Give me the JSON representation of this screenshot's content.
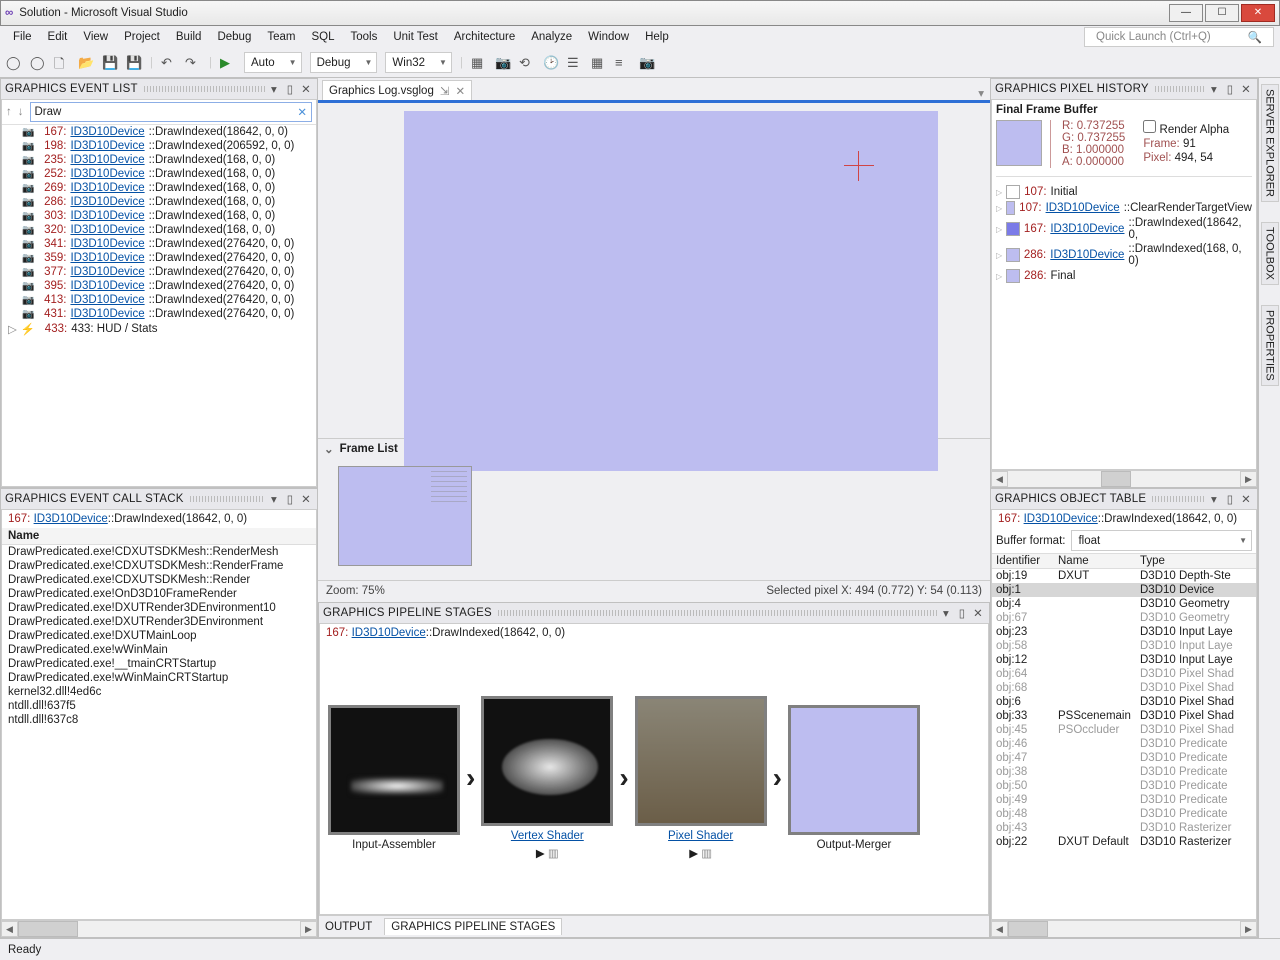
{
  "title": "Solution - Microsoft Visual Studio",
  "menubar": [
    "File",
    "Edit",
    "View",
    "Project",
    "Build",
    "Debug",
    "Team",
    "SQL",
    "Tools",
    "Unit Test",
    "Architecture",
    "Analyze",
    "Window",
    "Help"
  ],
  "quick_launch_placeholder": "Quick Launch (Ctrl+Q)",
  "toolbar": {
    "config_combo": "Auto",
    "solution_config": "Debug",
    "platform": "Win32"
  },
  "doc_tab": "Graphics Log.vsglog",
  "event_list": {
    "title": "GRAPHICS EVENT LIST",
    "filter": "Draw",
    "rows": [
      {
        "n": "167",
        "sig": "::DrawIndexed(18642, 0, 0)"
      },
      {
        "n": "198",
        "sig": "::DrawIndexed(206592, 0, 0)"
      },
      {
        "n": "235",
        "sig": "::DrawIndexed(168, 0, 0)"
      },
      {
        "n": "252",
        "sig": "::DrawIndexed(168, 0, 0)"
      },
      {
        "n": "269",
        "sig": "::DrawIndexed(168, 0, 0)"
      },
      {
        "n": "286",
        "sig": "::DrawIndexed(168, 0, 0)"
      },
      {
        "n": "303",
        "sig": "::DrawIndexed(168, 0, 0)"
      },
      {
        "n": "320",
        "sig": "::DrawIndexed(168, 0, 0)"
      },
      {
        "n": "341",
        "sig": "::DrawIndexed(276420, 0, 0)"
      },
      {
        "n": "359",
        "sig": "::DrawIndexed(276420, 0, 0)"
      },
      {
        "n": "377",
        "sig": "::DrawIndexed(276420, 0, 0)"
      },
      {
        "n": "395",
        "sig": "::DrawIndexed(276420, 0, 0)"
      },
      {
        "n": "413",
        "sig": "::DrawIndexed(276420, 0, 0)"
      },
      {
        "n": "431",
        "sig": "::DrawIndexed(276420, 0, 0)"
      }
    ],
    "last_row": "433: HUD / Stats",
    "link": "ID3D10Device"
  },
  "frame_list_label": "Frame List",
  "zoom": "Zoom: 75%",
  "selected_pixel": "Selected pixel X: 494 (0.772) Y: 54 (0.113)",
  "callstack": {
    "title": "GRAPHICS EVENT CALL STACK",
    "context_num": "167:",
    "context_link": "ID3D10Device",
    "context_sig": "::DrawIndexed(18642, 0, 0)",
    "header": "Name",
    "rows": [
      "DrawPredicated.exe!CDXUTSDKMesh::RenderMesh",
      "DrawPredicated.exe!CDXUTSDKMesh::RenderFrame",
      "DrawPredicated.exe!CDXUTSDKMesh::Render",
      "DrawPredicated.exe!OnD3D10FrameRender",
      "DrawPredicated.exe!DXUTRender3DEnvironment10",
      "DrawPredicated.exe!DXUTRender3DEnvironment",
      "DrawPredicated.exe!DXUTMainLoop",
      "DrawPredicated.exe!wWinMain",
      "DrawPredicated.exe!__tmainCRTStartup",
      "DrawPredicated.exe!wWinMainCRTStartup",
      "kernel32.dll!4ed6c",
      "ntdll.dll!637f5",
      "ntdll.dll!637c8"
    ]
  },
  "pipeline": {
    "title": "GRAPHICS PIPELINE STAGES",
    "context_num": "167:",
    "context_link": "ID3D10Device",
    "context_sig": "::DrawIndexed(18642, 0, 0)",
    "stages": [
      "Input-Assembler",
      "Vertex Shader",
      "Pixel Shader",
      "Output-Merger"
    ]
  },
  "bottom_tabs": [
    "OUTPUT",
    "GRAPHICS PIPELINE STAGES"
  ],
  "pixel_history": {
    "title": "GRAPHICS PIXEL HISTORY",
    "subtitle": "Final Frame Buffer",
    "rgba": [
      "R:   0.737255",
      "G:   0.737255",
      "B:   1.000000",
      "A:   0.000000"
    ],
    "render_alpha": "Render Alpha",
    "frame_label": "Frame:",
    "frame_value": "91",
    "pixel_label": "Pixel:",
    "pixel_value": "494, 54",
    "rows": [
      {
        "n": "107:",
        "text": "Initial",
        "link": false,
        "color": "#fff"
      },
      {
        "n": "107:",
        "text": "ID3D10Device",
        "suffix": "::ClearRenderTargetView",
        "link": true,
        "color": "#bdbdf0"
      },
      {
        "n": "167:",
        "text": "ID3D10Device",
        "suffix": "::DrawIndexed(18642, 0,",
        "link": true,
        "color": "#7b7be8"
      },
      {
        "n": "286:",
        "text": "ID3D10Device",
        "suffix": "::DrawIndexed(168, 0, 0)",
        "link": true,
        "color": "#bdbdf0"
      },
      {
        "n": "286:",
        "text": "Final",
        "link": false,
        "color": "#bdbdf0"
      }
    ]
  },
  "object_table": {
    "title": "GRAPHICS OBJECT TABLE",
    "context_num": "167:",
    "context_link": "ID3D10Device",
    "context_sig": "::DrawIndexed(18642, 0, 0)",
    "buffer_format_label": "Buffer format:",
    "buffer_format_value": "float",
    "cols": [
      "Identifier",
      "Name",
      "Type"
    ],
    "rows": [
      {
        "id": "obj:19",
        "nm": "DXUT",
        "tp": "D3D10 Depth-Ste",
        "dim": false
      },
      {
        "id": "obj:1",
        "nm": "",
        "tp": "D3D10 Device",
        "dim": false,
        "sel": true
      },
      {
        "id": "obj:4",
        "nm": "",
        "tp": "D3D10 Geometry",
        "dim": false
      },
      {
        "id": "obj:67",
        "nm": "",
        "tp": "D3D10 Geometry",
        "dim": true
      },
      {
        "id": "obj:23",
        "nm": "",
        "tp": "D3D10 Input Laye",
        "dim": false
      },
      {
        "id": "obj:58",
        "nm": "",
        "tp": "D3D10 Input Laye",
        "dim": true
      },
      {
        "id": "obj:12",
        "nm": "",
        "tp": "D3D10 Input Laye",
        "dim": false
      },
      {
        "id": "obj:64",
        "nm": "",
        "tp": "D3D10 Pixel Shad",
        "dim": true
      },
      {
        "id": "obj:68",
        "nm": "",
        "tp": "D3D10 Pixel Shad",
        "dim": true
      },
      {
        "id": "obj:6",
        "nm": "",
        "tp": "D3D10 Pixel Shad",
        "dim": false
      },
      {
        "id": "obj:33",
        "nm": "PSScenemain",
        "tp": "D3D10 Pixel Shad",
        "dim": false
      },
      {
        "id": "obj:45",
        "nm": "PSOccluder",
        "tp": "D3D10 Pixel Shad",
        "dim": true
      },
      {
        "id": "obj:46",
        "nm": "",
        "tp": "D3D10 Predicate",
        "dim": true
      },
      {
        "id": "obj:47",
        "nm": "",
        "tp": "D3D10 Predicate",
        "dim": true
      },
      {
        "id": "obj:38",
        "nm": "",
        "tp": "D3D10 Predicate",
        "dim": true
      },
      {
        "id": "obj:50",
        "nm": "",
        "tp": "D3D10 Predicate",
        "dim": true
      },
      {
        "id": "obj:49",
        "nm": "",
        "tp": "D3D10 Predicate",
        "dim": true
      },
      {
        "id": "obj:48",
        "nm": "",
        "tp": "D3D10 Predicate",
        "dim": true
      },
      {
        "id": "obj:43",
        "nm": "",
        "tp": "D3D10 Rasterizer",
        "dim": true
      },
      {
        "id": "obj:22",
        "nm": "DXUT Default",
        "tp": "D3D10 Rasterizer",
        "dim": false
      }
    ]
  },
  "right_tabs": [
    "SERVER EXPLORER",
    "TOOLBOX",
    "PROPERTIES"
  ],
  "status": "Ready"
}
